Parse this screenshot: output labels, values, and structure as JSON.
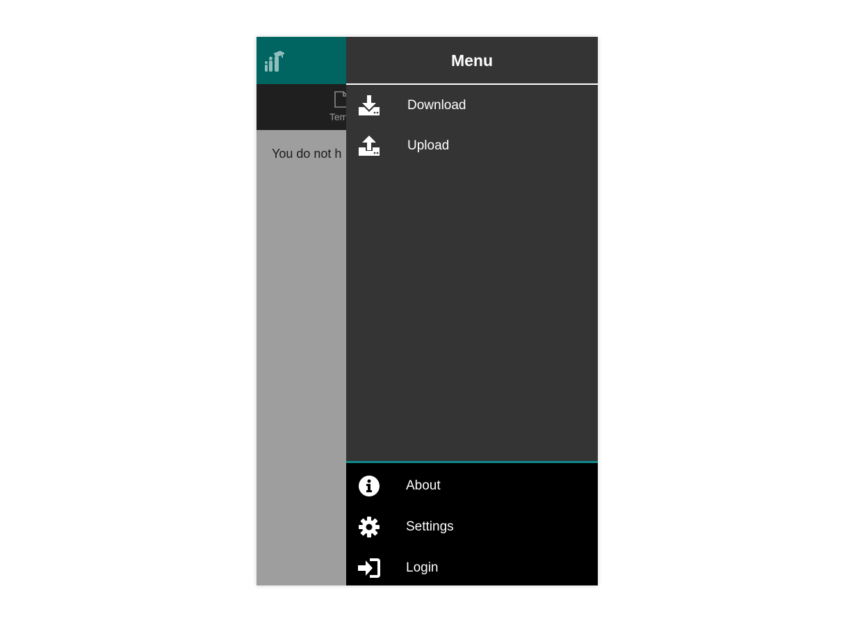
{
  "app": {
    "tab_label": "Temp",
    "empty_message": "You do not h",
    "header_color": "#006461",
    "logo_icon": "graduation-people-logo"
  },
  "drawer": {
    "title": "Menu",
    "items": [
      {
        "label": "Download",
        "icon": "download-icon"
      },
      {
        "label": "Upload",
        "icon": "upload-icon"
      }
    ],
    "footer_items": [
      {
        "label": "About",
        "icon": "info-icon"
      },
      {
        "label": "Settings",
        "icon": "gear-icon"
      },
      {
        "label": "Login",
        "icon": "login-icon"
      }
    ],
    "accent_color": "#0f8a8c"
  }
}
